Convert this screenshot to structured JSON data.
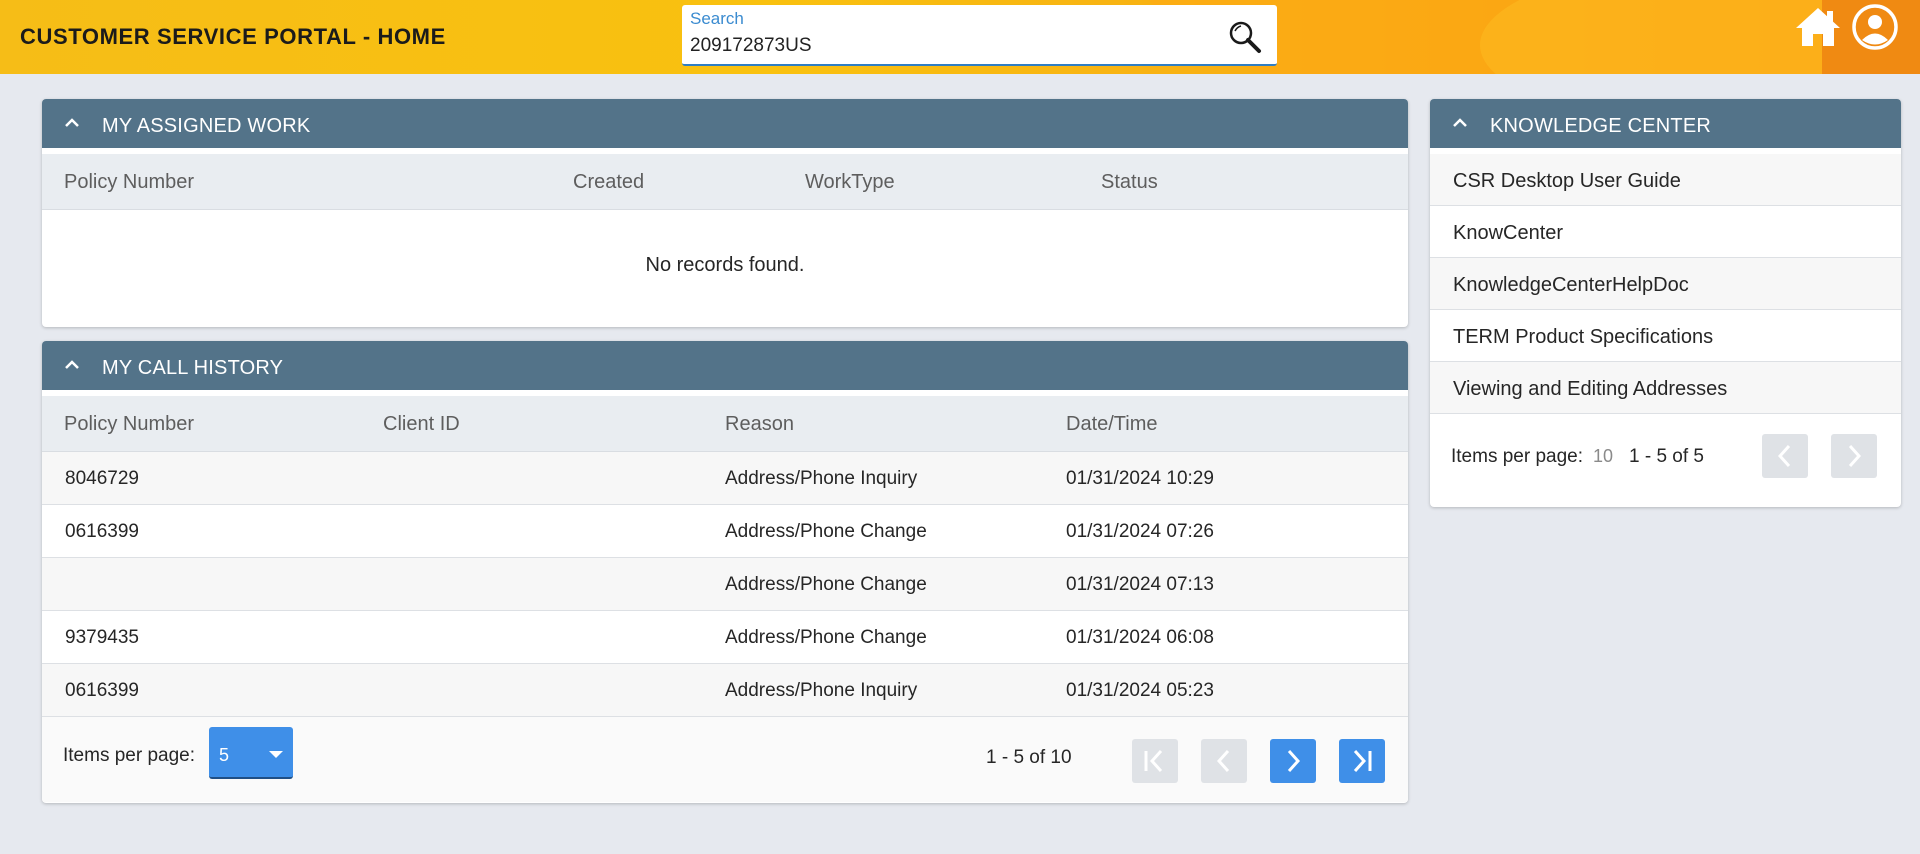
{
  "header": {
    "title": "CUSTOMER SERVICE PORTAL - HOME",
    "search": {
      "label": "Search",
      "value": "209172873US"
    }
  },
  "assigned_work": {
    "title": "MY ASSIGNED WORK",
    "columns": [
      "Policy Number",
      "Created",
      "WorkType",
      "Status"
    ],
    "empty_message": "No records found."
  },
  "call_history": {
    "title": "MY CALL HISTORY",
    "columns": [
      "Policy Number",
      "Client ID",
      "Reason",
      "Date/Time"
    ],
    "rows": [
      {
        "policy": "8046729",
        "client": "",
        "reason": "Address/Phone Inquiry",
        "datetime": "01/31/2024 10:29"
      },
      {
        "policy": "0616399",
        "client": "",
        "reason": "Address/Phone Change",
        "datetime": "01/31/2024 07:26"
      },
      {
        "policy": "",
        "client": "",
        "reason": "Address/Phone Change",
        "datetime": "01/31/2024 07:13"
      },
      {
        "policy": "9379435",
        "client": "",
        "reason": "Address/Phone Change",
        "datetime": "01/31/2024 06:08"
      },
      {
        "policy": "0616399",
        "client": "",
        "reason": "Address/Phone Inquiry",
        "datetime": "01/31/2024 05:23"
      }
    ],
    "pager": {
      "items_per_page_label": "Items per page:",
      "items_per_page": "5",
      "range": "1 - 5 of 10"
    }
  },
  "knowledge_center": {
    "title": "KNOWLEDGE CENTER",
    "items": [
      "CSR Desktop User Guide",
      "KnowCenter",
      "KnowledgeCenterHelpDoc",
      "TERM Product Specifications",
      "Viewing and Editing Addresses"
    ],
    "pager": {
      "items_per_page_label": "Items per page:",
      "items_per_page": "10",
      "range": "1 - 5 of 5"
    }
  },
  "colors": {
    "header_accent": "#f9c10f",
    "panel_header": "#537389",
    "primary_button": "#3f8fe8",
    "disabled_button": "#dfe2e6",
    "search_label": "#3a8bd0"
  },
  "icons": [
    "search-icon",
    "home-icon",
    "user-icon",
    "chevron-up-icon",
    "first-page-icon",
    "prev-page-icon",
    "next-page-icon",
    "last-page-icon",
    "caret-down-icon"
  ]
}
